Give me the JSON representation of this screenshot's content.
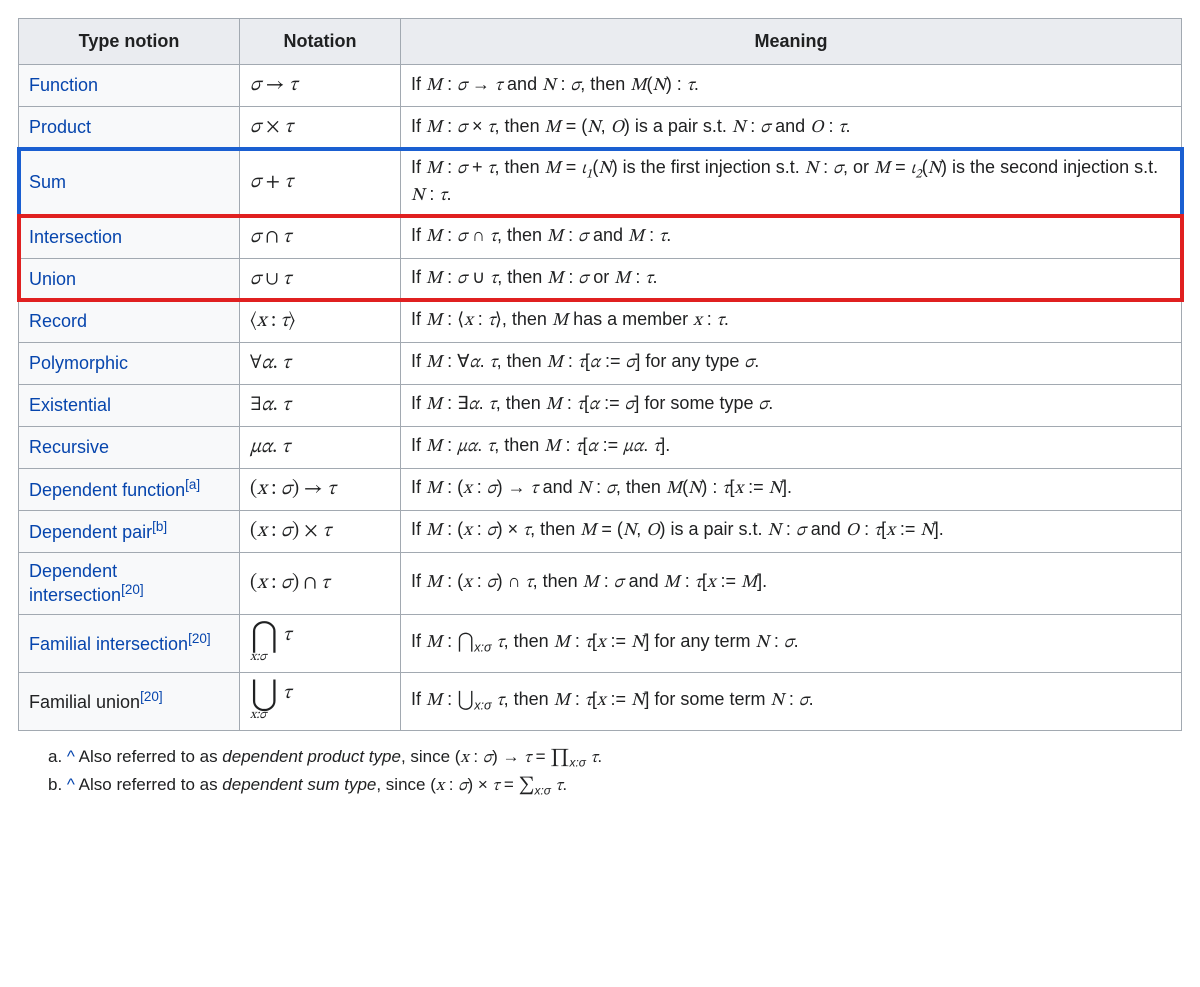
{
  "table": {
    "headers": [
      "Type notion",
      "Notation",
      "Meaning"
    ],
    "rows": [
      {
        "notion_html": "<span class='lk'>Function</span>",
        "notation_html": "<span class='math'>σ</span> <span class='mathup'>→</span> <span class='math'>τ</span>",
        "meaning_html": "If <span class='math'>M</span> : <span class='math'>σ</span> → <span class='math'>τ</span> and <span class='math'>N</span> : <span class='math'>σ</span>, then <span class='math'>M</span>(<span class='math'>N</span>) : <span class='math'>τ</span>."
      },
      {
        "notion_html": "<span class='lk'>Product</span>",
        "notation_html": "<span class='math'>σ</span> <span class='mathup'>×</span> <span class='math'>τ</span>",
        "meaning_html": "If <span class='math'>M</span> : <span class='math'>σ</span> × <span class='math'>τ</span>, then <span class='math'>M</span> = (<span class='math'>N</span>, <span class='math'>O</span>) is a pair s.t. <span class='math'>N</span> : <span class='math'>σ</span> and <span class='math'>O</span> : <span class='math'>τ</span>."
      },
      {
        "notion_html": "<span class='lk'>Sum</span>",
        "notation_html": "<span class='math'>σ</span> <span class='mathup'>+</span> <span class='math'>τ</span>",
        "meaning_html": "If <span class='math'>M</span> : <span class='math'>σ</span> + <span class='math'>τ</span>, then <span class='math'>M</span> = <span class='math'>ι</span><sub class='mathsub'>1</sub>(<span class='math'>N</span>) is the first injection s.t. <span class='math'>N</span> : <span class='math'>σ</span>, or <span class='math'>M</span> = <span class='math'>ι</span><sub class='mathsub'>2</sub>(<span class='math'>N</span>) is the second injection s.t. <span class='math'>N</span> : <span class='math'>τ</span>."
      },
      {
        "notion_html": "<span class='lk'>Intersection</span>",
        "notation_html": "<span class='math'>σ</span> <span class='mathup'>∩</span> <span class='math'>τ</span>",
        "meaning_html": "If <span class='math'>M</span> : <span class='math'>σ</span> ∩ <span class='math'>τ</span>, then <span class='math'>M</span> : <span class='math'>σ</span> and <span class='math'>M</span> : <span class='math'>τ</span>."
      },
      {
        "notion_html": "<span class='lk'>Union</span>",
        "notation_html": "<span class='math'>σ</span> <span class='mathup'>∪</span> <span class='math'>τ</span>",
        "meaning_html": "If <span class='math'>M</span> : <span class='math'>σ</span> ∪ <span class='math'>τ</span>, then <span class='math'>M</span> : <span class='math'>σ</span> or <span class='math'>M</span> : <span class='math'>τ</span>."
      },
      {
        "notion_html": "<span class='lk'>Record</span>",
        "notation_html": "<span class='mathup'>⟨</span><span class='math'>x</span> : <span class='math'>τ</span><span class='mathup'>⟩</span>",
        "meaning_html": "If <span class='math'>M</span> : ⟨<span class='math'>x</span> : <span class='math'>τ</span>⟩, then <span class='math'>M</span> has a member <span class='math'>x</span> : <span class='math'>τ</span>."
      },
      {
        "notion_html": "<span class='lk'>Polymorphic</span>",
        "notation_html": "<span class='mathup'>∀</span><span class='math'>α</span>. <span class='math'>τ</span>",
        "meaning_html": "If <span class='math'>M</span> : ∀<span class='math'>α</span>. <span class='math'>τ</span>, then <span class='math'>M</span> : <span class='math'>τ</span>[<span class='math'>α</span> := <span class='math'>σ</span>] for any type <span class='math'>σ</span>."
      },
      {
        "notion_html": "<span class='lk'>Existential</span>",
        "notation_html": "<span class='mathup'>∃</span><span class='math'>α</span>. <span class='math'>τ</span>",
        "meaning_html": "If <span class='math'>M</span> : ∃<span class='math'>α</span>. <span class='math'>τ</span>, then <span class='math'>M</span> : <span class='math'>τ</span>[<span class='math'>α</span> := <span class='math'>σ</span>] for some type <span class='math'>σ</span>."
      },
      {
        "notion_html": "<span class='lk'>Recursive</span>",
        "notation_html": "<span class='math'>μα</span>. <span class='math'>τ</span>",
        "meaning_html": "If <span class='math'>M</span> : <span class='math'>μα</span>. <span class='math'>τ</span>, then <span class='math'>M</span> : <span class='math'>τ</span>[<span class='math'>α</span> := <span class='math'>μα</span>. <span class='math'>τ</span>]."
      },
      {
        "notion_html": "<span class='lk'>Dependent function</span><sup class='ref'>[a]</sup>",
        "notation_html": "(<span class='math'>x</span> : <span class='math'>σ</span>) → <span class='math'>τ</span>",
        "meaning_html": "If <span class='math'>M</span> : (<span class='math'>x</span> : <span class='math'>σ</span>) → <span class='math'>τ</span> and <span class='math'>N</span> : <span class='math'>σ</span>, then <span class='math'>M</span>(<span class='math'>N</span>) : <span class='math'>τ</span>[<span class='math'>x</span> := <span class='math'>N</span>]."
      },
      {
        "notion_html": "<span class='lk'>Dependent pair</span><sup class='ref'>[b]</sup>",
        "notation_html": "(<span class='math'>x</span> : <span class='math'>σ</span>) × <span class='math'>τ</span>",
        "meaning_html": "If <span class='math'>M</span> : (<span class='math'>x</span> : <span class='math'>σ</span>) × <span class='math'>τ</span>, then <span class='math'>M</span> = (<span class='math'>N</span>, <span class='math'>O</span>) is a pair s.t. <span class='math'>N</span> : <span class='math'>σ</span> and <span class='math'>O</span> : <span class='math'>τ</span>[<span class='math'>x</span> := <span class='math'>N</span>]."
      },
      {
        "notion_html": "<span class='lk'>Dependent intersection</span><sup class='ref'>[20]</sup>",
        "notation_html": "(<span class='math'>x</span> : <span class='math'>σ</span>) ∩ <span class='math'>τ</span>",
        "meaning_html": "If <span class='math'>M</span> : (<span class='math'>x</span> : <span class='math'>σ</span>) ∩ <span class='math'>τ</span>, then <span class='math'>M</span> : <span class='math'>σ</span> and <span class='math'>M</span> : <span class='math'>τ</span>[<span class='math'>x</span> := <span class='math'>M</span>]."
      },
      {
        "notion_html": "<span class='lk'>Familial intersection</span><sup class='ref'>[20]</sup>",
        "notation_html": "<span class='stack'><span class='big'>⋂</span><span class='bot'>x:σ</span></span><span class='math' style='vertical-align:8px;'> τ</span>",
        "meaning_html": "If <span class='math'>M</span> : <span class='mathup'>⋂</span><sub class='xs'>x:σ</sub> <span class='math'>τ</span>, then <span class='math'>M</span> : <span class='math'>τ</span>[<span class='math'>x</span> := <span class='math'>N</span>] for any term <span class='math'>N</span> : <span class='math'>σ</span>."
      },
      {
        "notion_html": "<span class='plain'>Familial union</span><sup class='ref'>[20]</sup>",
        "notation_html": "<span class='stack'><span class='big'>⋃</span><span class='bot'>x:σ</span></span><span class='math' style='vertical-align:8px;'> τ</span>",
        "meaning_html": "If <span class='math'>M</span> : <span class='mathup'>⋃</span><sub class='xs'>x:σ</sub> <span class='math'>τ</span>, then <span class='math'>M</span> : <span class='math'>τ</span>[<span class='math'>x</span> := <span class='math'>N</span>] for some term <span class='math'>N</span> : <span class='math'>σ</span>."
      }
    ]
  },
  "highlights": {
    "blue_row_index": 2,
    "red_row_start": 3,
    "red_row_end": 4
  },
  "footnotes": [
    {
      "label": "a.",
      "body_html": "<span class='mark'>^</span> Also referred to as <em>dependent product type</em>, since (<span class='math'>x</span> : <span class='math'>σ</span>) → <span class='math'>τ</span> = <span class='mathup'>∏</span><sub class='xs'>x:σ</sub> <span class='math'>τ</span>."
    },
    {
      "label": "b.",
      "body_html": "<span class='mark'>^</span> Also referred to as <em>dependent sum type</em>, since (<span class='math'>x</span> : <span class='math'>σ</span>) × <span class='math'>τ</span> = <span class='mathup'>∑</span><sub class='xs'>x:σ</sub> <span class='math'>τ</span>."
    }
  ]
}
